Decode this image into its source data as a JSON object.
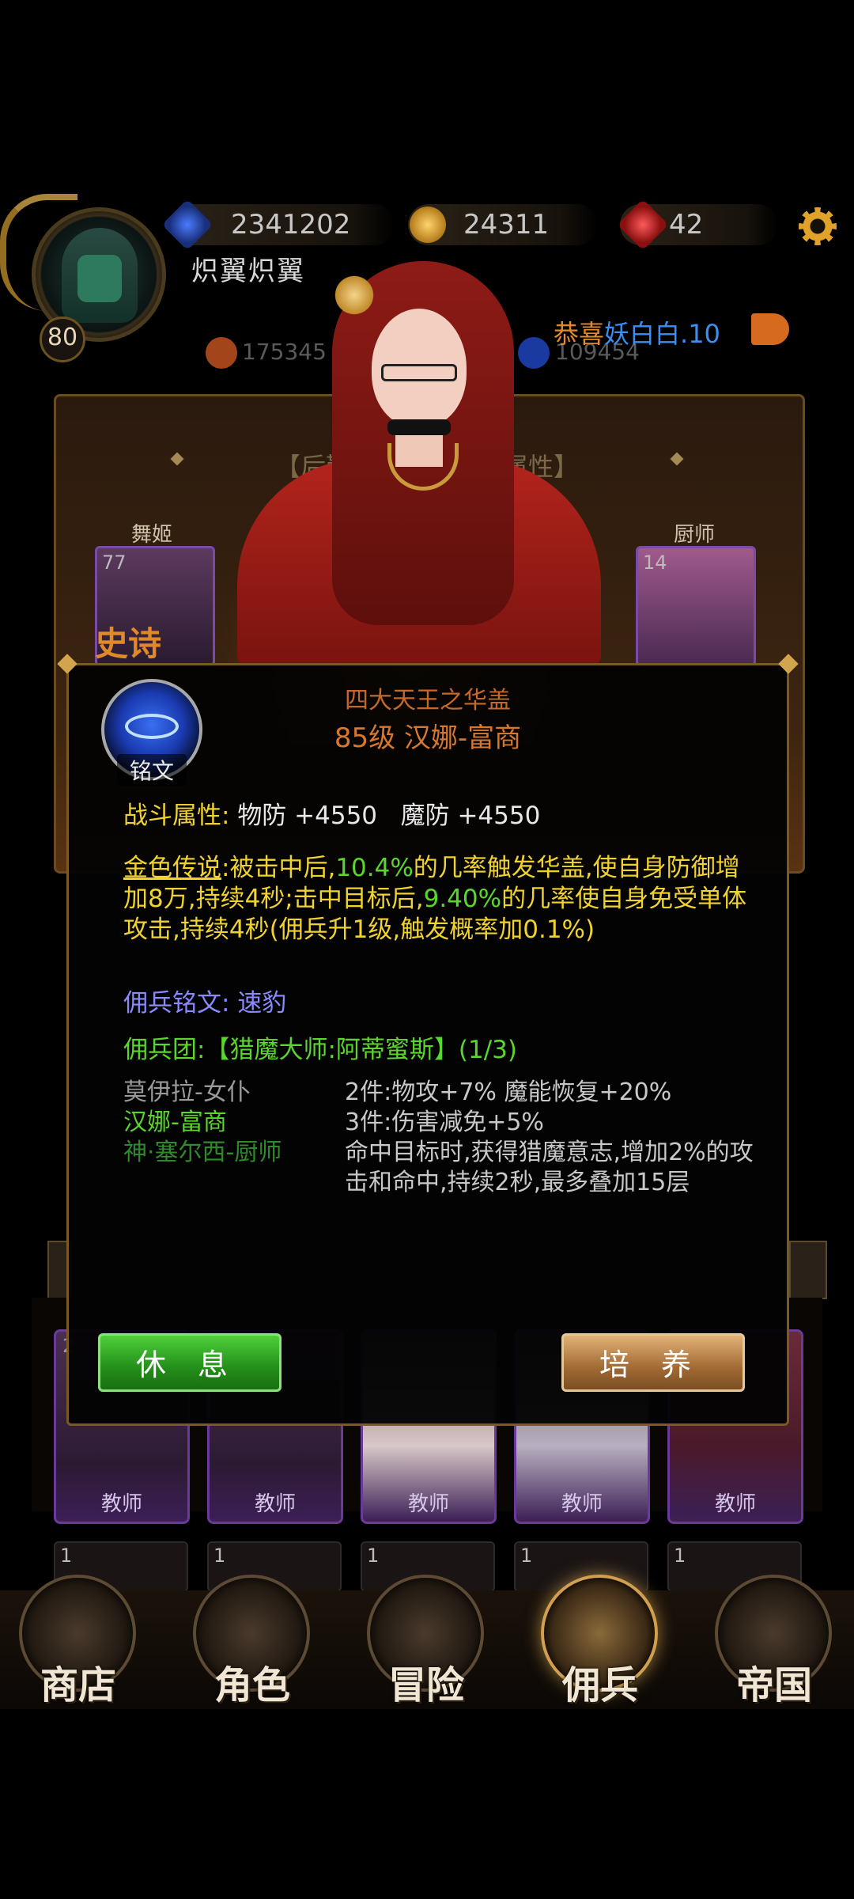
{
  "hud": {
    "level": "80",
    "player_name": "炽翼炽翼",
    "resource_1": "2341202",
    "resource_2": "24311",
    "resource_3": "42",
    "sub_resource_1": "175345",
    "sub_resource_2": "109454",
    "announce_prefix": "恭喜",
    "announce_name": "妖白白.10"
  },
  "background_panel": {
    "title": "【后勤佣兵增加角色属性】",
    "slot_labels": [
      "舞姬",
      "厨师"
    ],
    "slot_levels": [
      "77",
      "14"
    ],
    "rarity": "史诗"
  },
  "modal": {
    "emblem_label": "铭文",
    "set_name": "四大天王之华盖",
    "item_title": "85级 汉娜-富商",
    "combat_label": "战斗属性:",
    "combat_values": "物防 +4550   魔防 +4550",
    "lore_title": "金色传说",
    "lore_1": ":被击中后,",
    "lore_pct1": "10.4%",
    "lore_2": "的几率触发华盖,使自身防御增加8万,持续4秒;击中目标后,",
    "lore_pct2": "9.40%",
    "lore_3": "的几率使自身免受单体攻击,持续4秒(佣兵升1级,触发概率加0.1%)",
    "inscription_label": "佣兵铭文:",
    "inscription_value": "速豹",
    "group_label": "佣兵团:【猎魔大师:阿蒂蜜斯】(1/3)",
    "members": [
      "莫伊拉-女仆",
      "汉娜-富商",
      "神·塞尔西-厨师"
    ],
    "bonus_2": "2件:物攻+7% 魔能恢复+20%",
    "bonus_3": "3件:伤害减免+5%",
    "bonus_desc": "命中目标时,获得猎魔意志,增加2%的攻击和命中,持续2秒,最多叠加15层",
    "rest_button": "休息",
    "train_button": "培养"
  },
  "roster": {
    "cards": [
      "教师",
      "教师",
      "教师",
      "教师",
      "教师"
    ],
    "card_num": "2",
    "row2_num": "1"
  },
  "nav": {
    "items": [
      "商店",
      "角色",
      "冒险",
      "佣兵",
      "帝国"
    ],
    "active_index": 3
  },
  "colors": {
    "accent_gold": "#d1a44e",
    "title_orange": "#d7782f",
    "highlight_green": "#5ad62c",
    "label_yellow": "#f0d230",
    "inscription_blue": "#8a8aff"
  }
}
